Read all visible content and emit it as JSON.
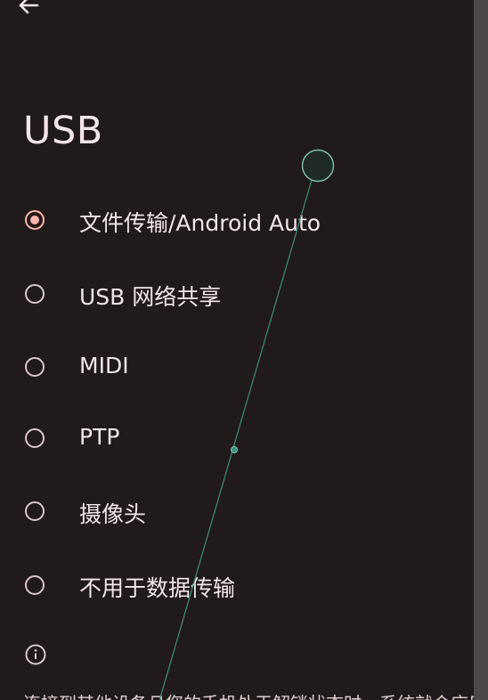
{
  "header": {
    "back_icon": "arrow-back-icon",
    "title": "USB"
  },
  "options": [
    {
      "label": "文件传输/Android Auto",
      "selected": true
    },
    {
      "label": "USB 网络共享",
      "selected": false
    },
    {
      "label": "MIDI",
      "selected": false
    },
    {
      "label": "PTP",
      "selected": false
    },
    {
      "label": "摄像头",
      "selected": false
    },
    {
      "label": "不用于数据传输",
      "selected": false
    }
  ],
  "info": {
    "icon": "info-icon",
    "text": "连接到其他设备且您的手机处于解锁状态时，系统就会应用"
  },
  "colors": {
    "background": "#211a1a",
    "accent": "#ffb4ab",
    "text": "#f4e6e6",
    "pointer_trace": "#3a8f80"
  }
}
